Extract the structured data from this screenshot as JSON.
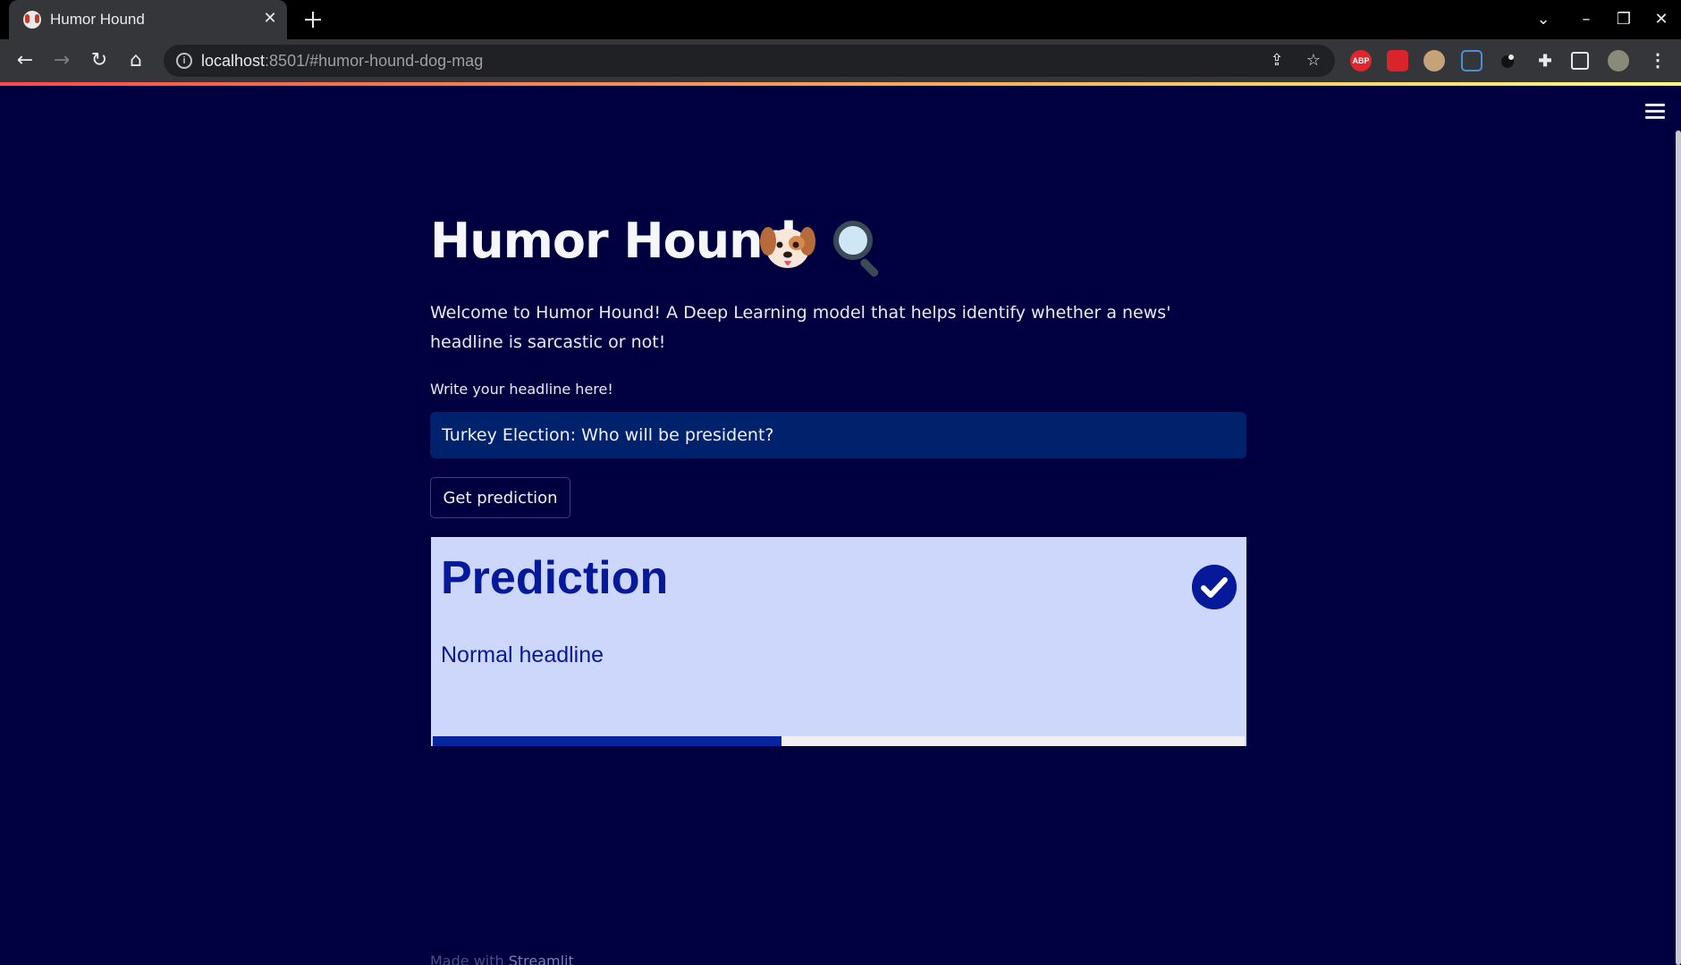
{
  "browser": {
    "tab_title": "Humor Hound",
    "url_host": "localhost",
    "url_rest": ":8501/#humor-hound-dog-mag",
    "extensions": [
      "adblock-plus-icon",
      "mendeley-icon",
      "owl-extension-icon",
      "translate-icon",
      "dark-reader-icon",
      "extensions-puzzle-icon",
      "side-panel-icon",
      "profile-avatar"
    ],
    "ext_labels": {
      "abp": "ABP"
    }
  },
  "app": {
    "title": "Humor Hound",
    "intro": "Welcome to Humor Hound! A Deep Learning model that helps identify whether a news' headline is sarcastic or not!",
    "input_label": "Write your headline here!",
    "input_value": "Turkey Election: Who will be president?",
    "button_label": "Get prediction",
    "result": {
      "title": "Prediction",
      "text": "Normal headline",
      "confidence": 0.43
    },
    "footer": {
      "made_with": "Made with ",
      "brand": "Streamlit"
    }
  },
  "colors": {
    "background": "#000040",
    "input_bg": "#00216b",
    "card_bg": "#cdd6fb",
    "accent": "#06199a",
    "progress": "#06249f"
  }
}
